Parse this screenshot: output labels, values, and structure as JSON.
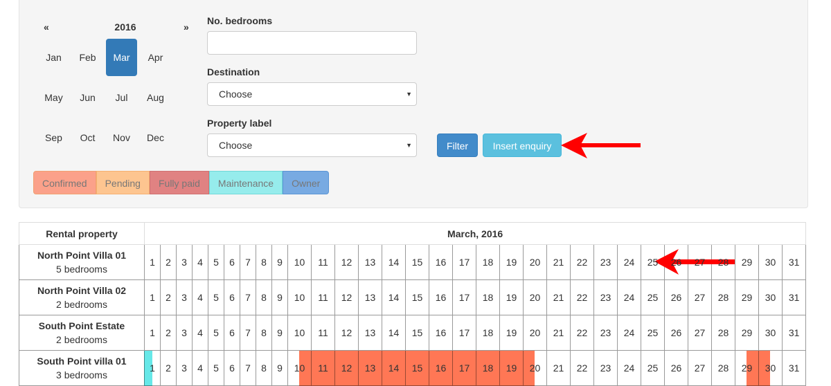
{
  "month_picker": {
    "prev": "«",
    "year": "2016",
    "next": "»",
    "selected": "Mar",
    "months": [
      "Jan",
      "Feb",
      "Mar",
      "Apr",
      "May",
      "Jun",
      "Jul",
      "Aug",
      "Sep",
      "Oct",
      "Nov",
      "Dec"
    ]
  },
  "filters": {
    "bedrooms": {
      "label": "No. bedrooms",
      "value": "",
      "placeholder": ""
    },
    "destination": {
      "label": "Destination",
      "value": "Choose"
    },
    "property_label": {
      "label": "Property label",
      "value": "Choose"
    }
  },
  "buttons": {
    "filter": "Filter",
    "insert_enquiry": "Insert enquiry"
  },
  "legend": [
    {
      "label": "Confirmed",
      "color": "#fba18a",
      "border": "#f0a070"
    },
    {
      "label": "Pending",
      "color": "#fdc590",
      "border": "#f5b070"
    },
    {
      "label": "Fully paid",
      "color": "#e08282",
      "border": "#d07070"
    },
    {
      "label": "Maintenance",
      "color": "#96ecec",
      "border": "#70d8d8"
    },
    {
      "label": "Owner",
      "color": "#78aae2",
      "border": "#5a94d4"
    }
  ],
  "table": {
    "header_property": "Rental property",
    "header_month": "March, 2016",
    "days": [
      1,
      2,
      3,
      4,
      5,
      6,
      7,
      8,
      9,
      10,
      11,
      12,
      13,
      14,
      15,
      16,
      17,
      18,
      19,
      20,
      21,
      22,
      23,
      24,
      25,
      26,
      27,
      28,
      29,
      30,
      31
    ],
    "rows": [
      {
        "name": "North Point Villa 01",
        "bedrooms": "5 bedrooms",
        "bookings": []
      },
      {
        "name": "North Point Villa 02",
        "bedrooms": "2 bedrooms",
        "bookings": []
      },
      {
        "name": "South Point Estate",
        "bedrooms": "2 bedrooms",
        "bookings": []
      },
      {
        "name": "South Point villa 01",
        "bedrooms": "3 bedrooms",
        "bookings": [
          {
            "to_day": 1,
            "color": "#66e8e8"
          },
          {
            "from_day": 10,
            "to_day": 20,
            "color": "#ff7755"
          },
          {
            "from_day": 29,
            "to_day": 30,
            "color": "#ff7755"
          }
        ]
      }
    ]
  },
  "colors": {
    "accent": "#337ab7",
    "filter": "#428bca",
    "insert": "#5bc0de",
    "annotation_arrow": "#ff0000"
  }
}
